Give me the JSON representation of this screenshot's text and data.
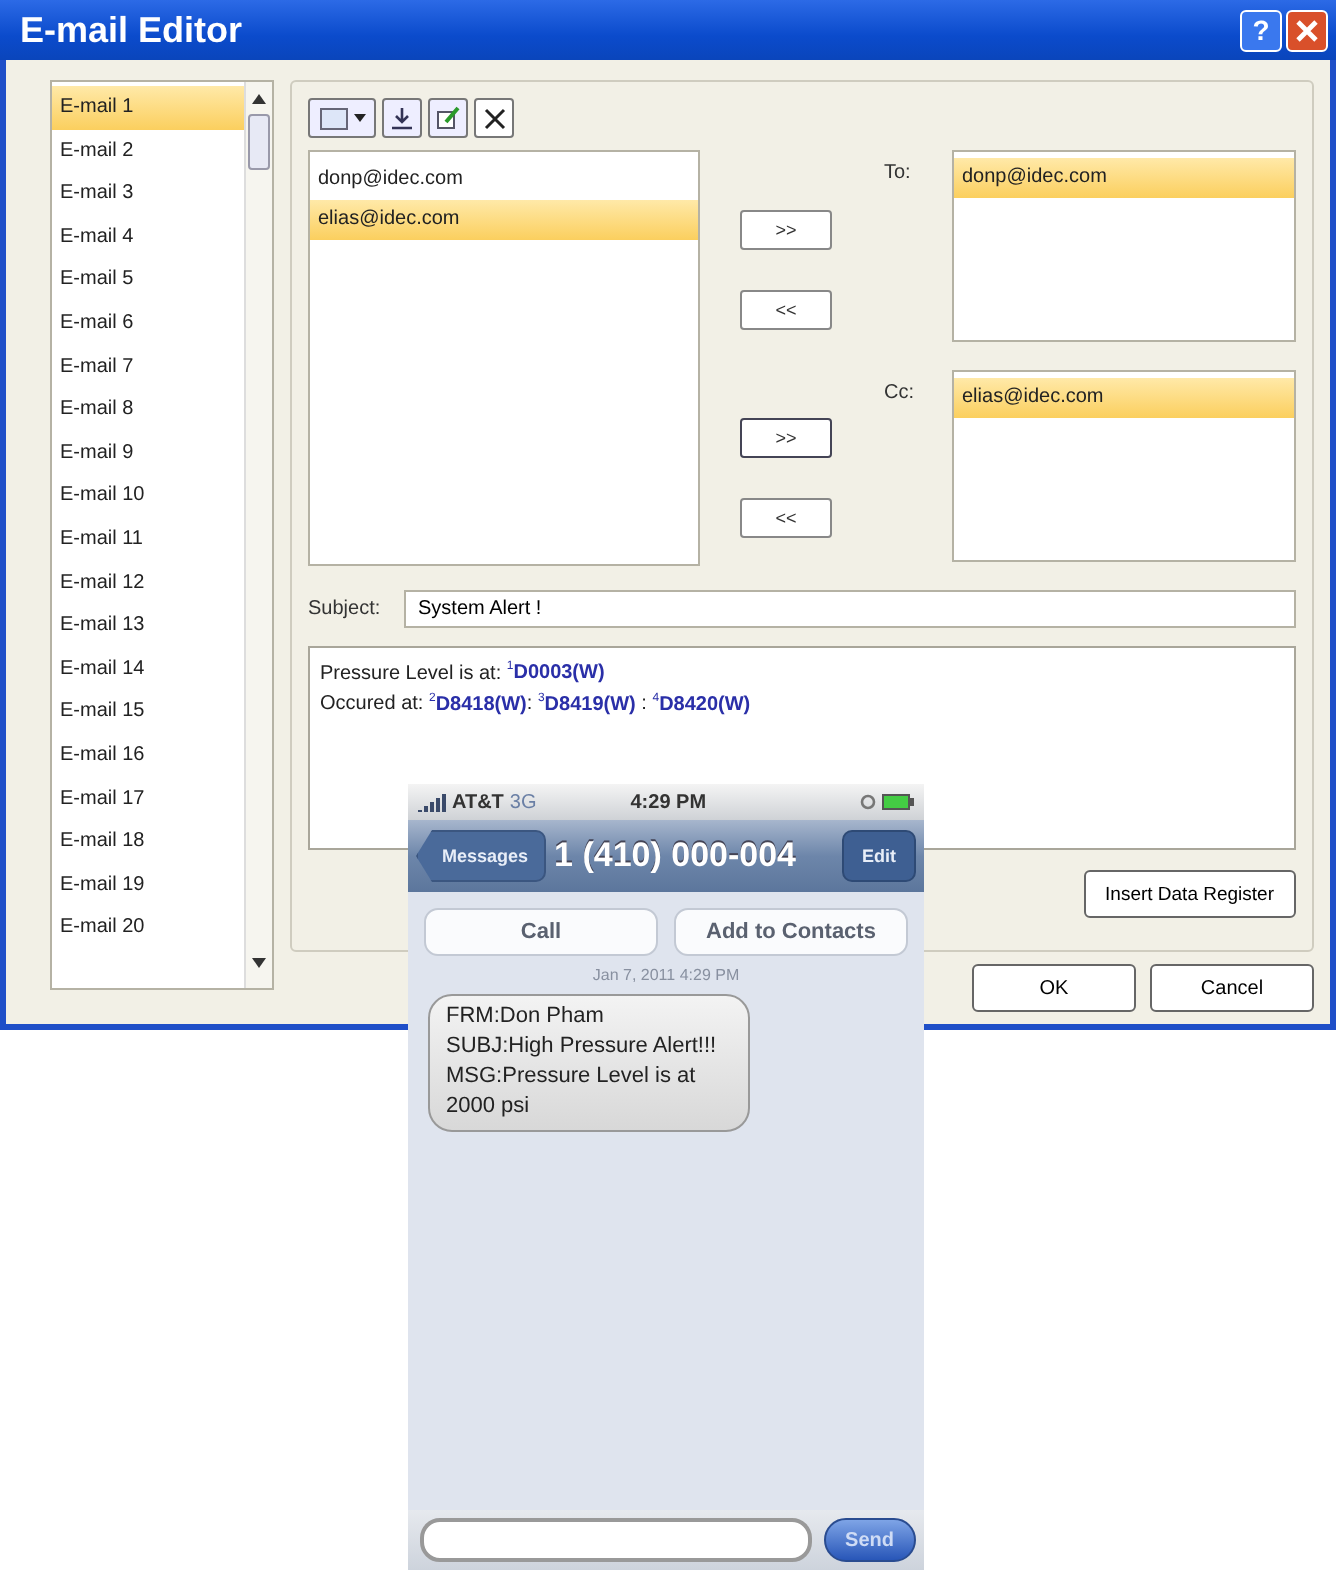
{
  "window": {
    "title": "E-mail Editor",
    "help": "?"
  },
  "emails": [
    {
      "label": "E-mail 1",
      "selected": true
    },
    {
      "label": "E-mail 2",
      "selected": false
    },
    {
      "label": "E-mail 3",
      "selected": false
    },
    {
      "label": "E-mail 4",
      "selected": false
    },
    {
      "label": "E-mail 5",
      "selected": false
    },
    {
      "label": "E-mail 6",
      "selected": false
    },
    {
      "label": "E-mail 7",
      "selected": false
    },
    {
      "label": "E-mail 8",
      "selected": false
    },
    {
      "label": "E-mail 9",
      "selected": false
    },
    {
      "label": "E-mail 10",
      "selected": false
    },
    {
      "label": "E-mail 11",
      "selected": false
    },
    {
      "label": "E-mail 12",
      "selected": false
    },
    {
      "label": "E-mail 13",
      "selected": false
    },
    {
      "label": "E-mail 14",
      "selected": false
    },
    {
      "label": "E-mail 15",
      "selected": false
    },
    {
      "label": "E-mail 16",
      "selected": false
    },
    {
      "label": "E-mail 17",
      "selected": false
    },
    {
      "label": "E-mail 18",
      "selected": false
    },
    {
      "label": "E-mail 19",
      "selected": false
    },
    {
      "label": "E-mail 20",
      "selected": false
    }
  ],
  "addresses": [
    {
      "label": "donp@idec.com",
      "selected": false
    },
    {
      "label": "elias@idec.com",
      "selected": true
    }
  ],
  "recipients": [
    {
      "label": "To:",
      "add": ">>",
      "remove": "<<",
      "items": [
        {
          "label": "donp@idec.com",
          "selected": true
        }
      ]
    },
    {
      "label": "Cc:",
      "add": ">>",
      "remove": "<<",
      "items": [
        {
          "label": "elias@idec.com",
          "selected": true
        }
      ]
    }
  ],
  "subject": {
    "label": "Subject:",
    "value": "System Alert !"
  },
  "body": [
    [
      {
        "kind": "text",
        "text": "Pressure Level is at: "
      },
      {
        "kind": "register",
        "index": "1",
        "text": "D0003(W)"
      }
    ],
    [
      {
        "kind": "text",
        "text": "Occured at: "
      },
      {
        "kind": "register",
        "index": "2",
        "text": "D8418(W)"
      },
      {
        "kind": "text",
        "text": ": "
      },
      {
        "kind": "register",
        "index": "3",
        "text": "D8419(W)"
      },
      {
        "kind": "text",
        "text": " : "
      },
      {
        "kind": "register",
        "index": "4",
        "text": "D8420(W)"
      }
    ]
  ],
  "insert_button": "Insert Data Register",
  "buttons": [
    "OK",
    "Cancel"
  ],
  "phone": {
    "carrier": "AT&T",
    "network": "3G",
    "time": "4:29 PM",
    "back": "Messages",
    "contact": "1 (410) 000-004",
    "edit": "Edit",
    "actions": [
      "Call",
      "Add to Contacts"
    ],
    "date": "Jan 7, 2011 4:29 PM",
    "message": [
      "FRM:Don Pham",
      "SUBJ:High Pressure Alert!!!",
      "MSG:Pressure Level is at",
      "2000 psi"
    ],
    "send": "Send"
  }
}
